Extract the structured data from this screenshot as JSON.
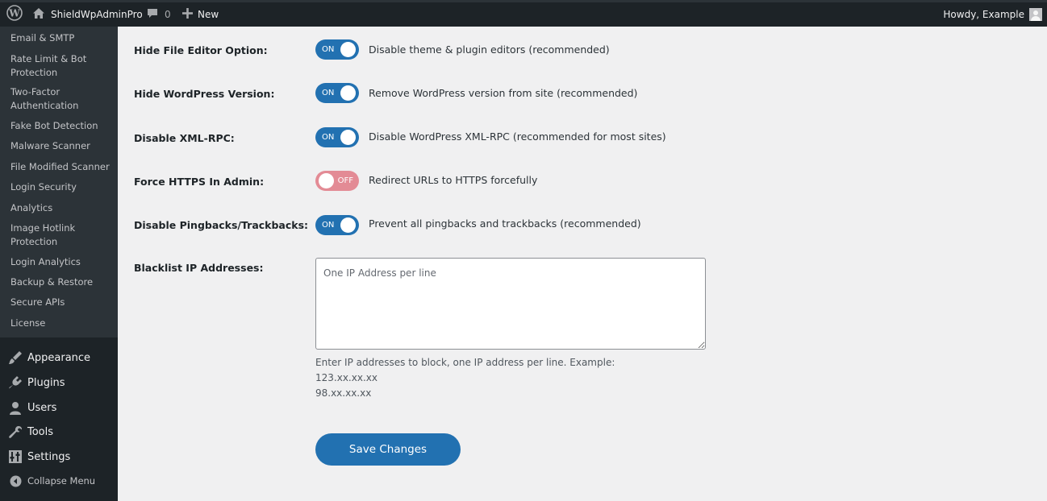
{
  "adminbar": {
    "site_name": "ShieldWpAdminPro",
    "comments_count": "0",
    "new_label": "New",
    "howdy": "Howdy, Example",
    "icons": {
      "wp": "wordpress-logo-icon",
      "home": "home-icon",
      "comments": "comment-bubble-icon",
      "new": "plus-icon",
      "avatar": "user-avatar-icon"
    }
  },
  "sidebar": {
    "submenu": [
      "Email & SMTP",
      "Rate Limit & Bot Protection",
      "Two-Factor Authentication",
      "Fake Bot Detection",
      "Malware Scanner",
      "File Modified Scanner",
      "Login Security",
      "Analytics",
      "Image Hotlink Protection",
      "Login Analytics",
      "Backup & Restore",
      "Secure APIs",
      "License"
    ],
    "menu": [
      {
        "label": "Appearance",
        "icon": "paintbrush-icon"
      },
      {
        "label": "Plugins",
        "icon": "plug-icon"
      },
      {
        "label": "Users",
        "icon": "user-icon"
      },
      {
        "label": "Tools",
        "icon": "wrench-icon"
      },
      {
        "label": "Settings",
        "icon": "sliders-icon"
      },
      {
        "label": "Collapse Menu",
        "icon": "collapse-arrow-icon"
      }
    ]
  },
  "settings": {
    "rows": [
      {
        "label": "Hide File Editor Option:",
        "state": "ON",
        "description": "Disable theme & plugin editors (recommended)"
      },
      {
        "label": "Hide WordPress Version:",
        "state": "ON",
        "description": "Remove WordPress version from site (recommended)"
      },
      {
        "label": "Disable XML-RPC:",
        "state": "ON",
        "description": "Disable WordPress XML-RPC (recommended for most sites)"
      },
      {
        "label": "Force HTTPS In Admin:",
        "state": "OFF",
        "description": "Redirect URLs to HTTPS forcefully"
      },
      {
        "label": "Disable Pingbacks/Trackbacks:",
        "state": "ON",
        "description": "Prevent all pingbacks and trackbacks (recommended)"
      }
    ],
    "blacklist": {
      "label": "Blacklist IP Addresses:",
      "value": "",
      "placeholder": "One IP Address per line",
      "help_line1": "Enter IP addresses to block, one IP address per line. Example:",
      "help_line2": "123.xx.xx.xx",
      "help_line3": "98.xx.xx.xx"
    },
    "save_label": "Save Changes"
  },
  "colors": {
    "accent": "#2271b1",
    "toggle_off": "#e38b95",
    "adminbar_bg": "#1d2327",
    "submenu_bg": "#2c3338",
    "page_bg": "#f0f0f1"
  }
}
